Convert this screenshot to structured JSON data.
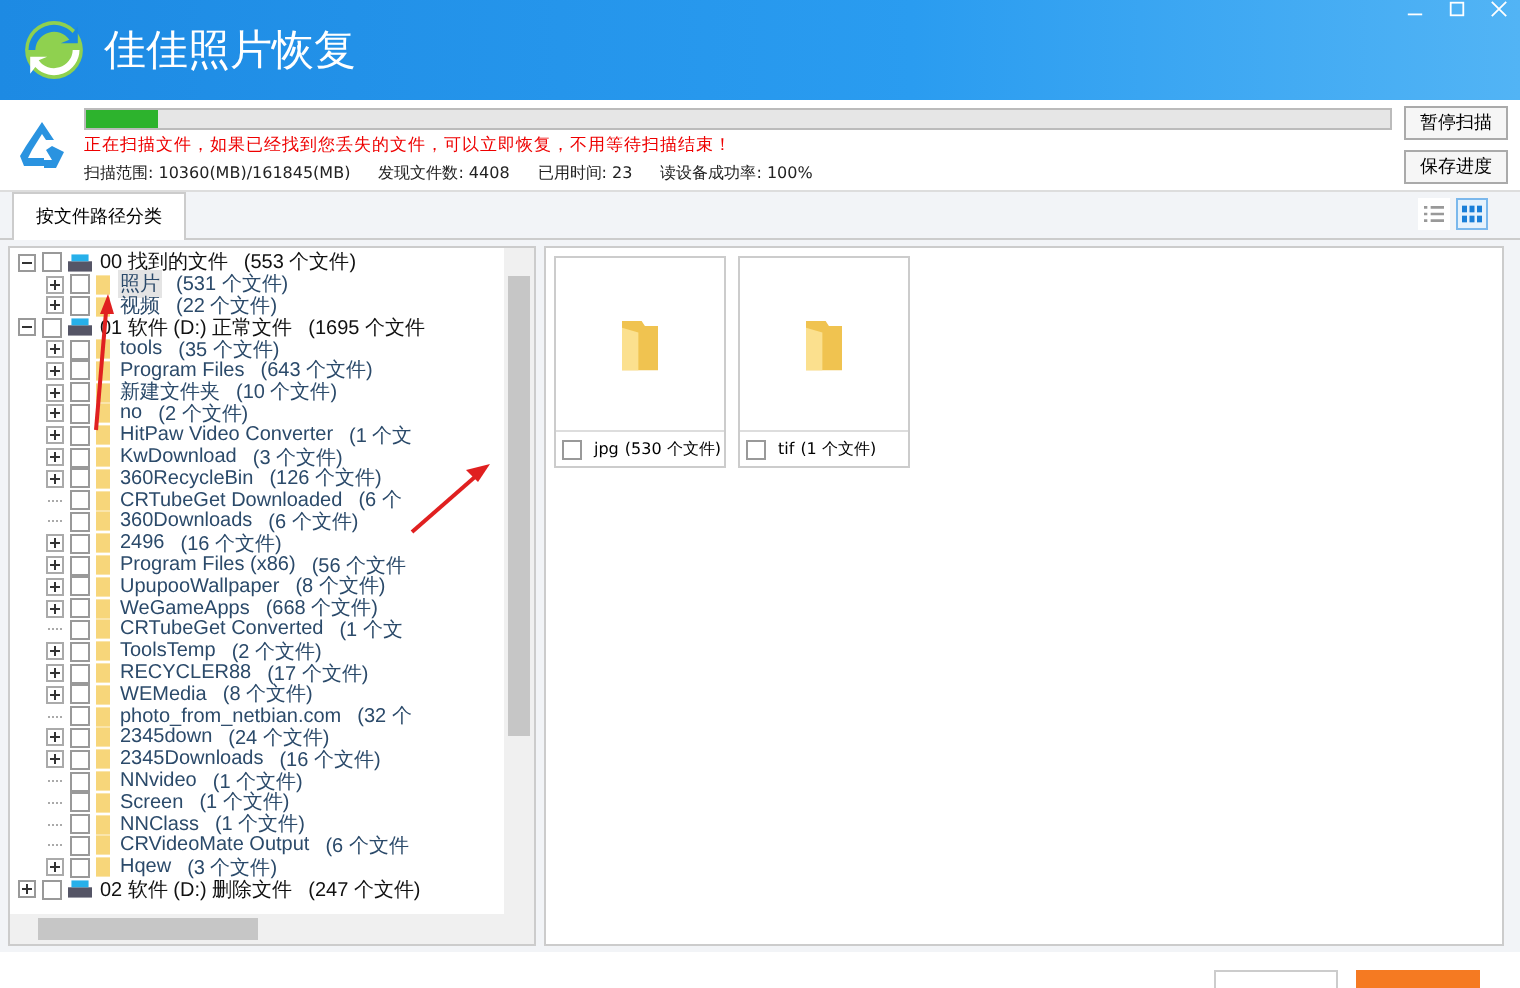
{
  "window": {
    "title": "佳佳照片恢复"
  },
  "scan": {
    "level": 0.055,
    "message": "正在扫描文件，如果已经找到您丢失的文件，可以立即恢复，不用等待扫描结束！",
    "stats": [
      "扫描范围: 10360(MB)/161845(MB)",
      "发现文件数: 4408",
      "已用时间: 23",
      "读设备成功率: 100%"
    ],
    "buttons": [
      "暂停扫描",
      "保存进度"
    ]
  },
  "tabs": [
    {
      "label": "按文件路径分类",
      "selected": true
    }
  ],
  "view_modes": [
    {
      "kind": "list",
      "selected": false
    },
    {
      "kind": "grid",
      "selected": true
    }
  ],
  "tree": [
    {
      "name": "00 找到的文件",
      "count": "(553 个文件)",
      "checked": false,
      "expanded": true,
      "selected": false,
      "children": [
        {
          "name": "照片",
          "count": "(531 个文件)",
          "kind": "branch",
          "checked": false,
          "selected": true
        },
        {
          "name": "视频",
          "count": "(22 个文件)",
          "kind": "branch",
          "checked": false,
          "selected": false
        }
      ]
    },
    {
      "name": "01 软件 (D:) 正常文件",
      "count": "(1695 个文件",
      "checked": false,
      "expanded": true,
      "selected": false,
      "children": [
        {
          "name": "tools",
          "count": "(35 个文件)",
          "kind": "branch",
          "checked": false,
          "selected": false
        },
        {
          "name": "Program Files",
          "count": "(643 个文件)",
          "kind": "branch",
          "checked": false,
          "selected": false
        },
        {
          "name": "新建文件夹",
          "count": "(10 个文件)",
          "kind": "branch",
          "checked": false,
          "selected": false
        },
        {
          "name": "no",
          "count": "(2 个文件)",
          "kind": "branch",
          "checked": false,
          "selected": false
        },
        {
          "name": "HitPaw Video Converter",
          "count": "(1 个文",
          "kind": "branch",
          "checked": false,
          "selected": false
        },
        {
          "name": "KwDownload",
          "count": "(3 个文件)",
          "kind": "branch",
          "checked": false,
          "selected": false
        },
        {
          "name": "360RecycleBin",
          "count": "(126 个文件)",
          "kind": "branch",
          "checked": false,
          "selected": false
        },
        {
          "name": "CRTubeGet Downloaded",
          "count": "(6 个",
          "kind": "leaf",
          "checked": false,
          "selected": false
        },
        {
          "name": "360Downloads",
          "count": "(6 个文件)",
          "kind": "leaf",
          "checked": false,
          "selected": false
        },
        {
          "name": "2496",
          "count": "(16 个文件)",
          "kind": "branch",
          "checked": false,
          "selected": false
        },
        {
          "name": "Program Files (x86)",
          "count": "(56 个文件",
          "kind": "branch",
          "checked": false,
          "selected": false
        },
        {
          "name": "UpupooWallpaper",
          "count": "(8 个文件)",
          "kind": "branch",
          "checked": false,
          "selected": false
        },
        {
          "name": "WeGameApps",
          "count": "(668 个文件)",
          "kind": "branch",
          "checked": false,
          "selected": false
        },
        {
          "name": "CRTubeGet Converted",
          "count": "(1 个文",
          "kind": "leaf",
          "checked": false,
          "selected": false
        },
        {
          "name": "ToolsTemp",
          "count": "(2 个文件)",
          "kind": "branch",
          "checked": false,
          "selected": false
        },
        {
          "name": "RECYCLER88",
          "count": "(17 个文件)",
          "kind": "branch",
          "checked": false,
          "selected": false
        },
        {
          "name": "WEMedia",
          "count": "(8 个文件)",
          "kind": "branch",
          "checked": false,
          "selected": false
        },
        {
          "name": "photo_from_netbian.com",
          "count": "(32 个",
          "kind": "leaf",
          "checked": false,
          "selected": false
        },
        {
          "name": "2345down",
          "count": "(24 个文件)",
          "kind": "branch",
          "checked": false,
          "selected": false
        },
        {
          "name": "2345Downloads",
          "count": "(16 个文件)",
          "kind": "branch",
          "checked": false,
          "selected": false
        },
        {
          "name": "NNvideo",
          "count": "(1 个文件)",
          "kind": "leaf",
          "checked": false,
          "selected": false
        },
        {
          "name": "Screen",
          "count": "(1 个文件)",
          "kind": "leaf",
          "checked": false,
          "selected": false
        },
        {
          "name": "NNClass",
          "count": "(1 个文件)",
          "kind": "leaf",
          "checked": false,
          "selected": false
        },
        {
          "name": "CRVideoMate Output",
          "count": "(6 个文件",
          "kind": "leaf",
          "checked": false,
          "selected": false
        },
        {
          "name": "Hqew",
          "count": "(3 个文件)",
          "kind": "branch",
          "checked": false,
          "selected": false
        }
      ]
    },
    {
      "name": "02 软件 (D:) 删除文件",
      "count": "(247 个文件)",
      "checked": false,
      "expanded": false,
      "selected": false
    }
  ],
  "cards": [
    {
      "name": "jpg",
      "count": "(530 个文件)",
      "checked": false
    },
    {
      "name": "tif",
      "count": "(1 个文件)",
      "checked": false
    }
  ]
}
